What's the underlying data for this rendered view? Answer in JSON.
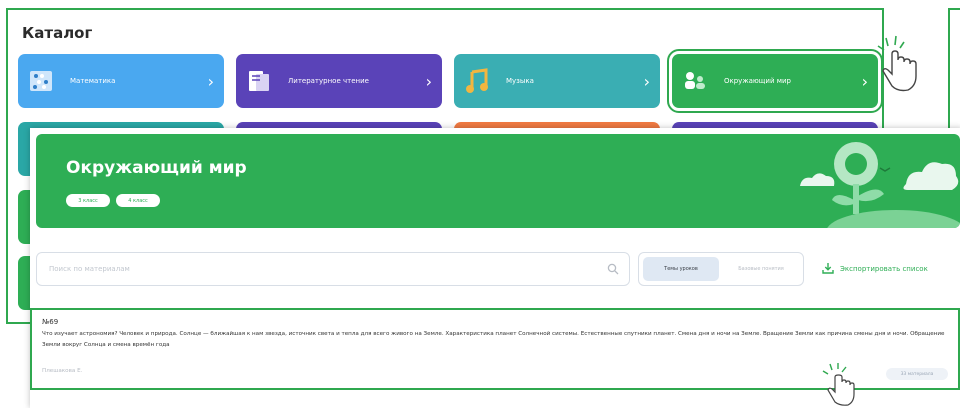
{
  "catalog": {
    "title": "Каталог",
    "tiles": [
      {
        "label": "Математика",
        "color": "#4aa8f0",
        "icon": "abacus-icon"
      },
      {
        "label": "Литературное чтение",
        "color": "#5a43b8",
        "icon": "book-icon"
      },
      {
        "label": "Музыка",
        "color": "#3aaeb3",
        "icon": "music-note-icon"
      },
      {
        "label": "Окружающий мир",
        "color": "#2eae55",
        "icon": "people-nature-icon"
      }
    ],
    "row2_colors": [
      "#2aa7a6",
      "#5a43b8",
      "#f07a43",
      "#5a43b8"
    ]
  },
  "subject": {
    "title": "Окружающий мир",
    "grades": [
      "3 класс",
      "4 класс"
    ],
    "banner_color": "#2eae55"
  },
  "search": {
    "placeholder": "Поиск по материалам"
  },
  "view_toggle": {
    "topics": "Темы уроков",
    "concepts": "Базовые понятия"
  },
  "export": {
    "label": "Экспортировать список"
  },
  "item": {
    "number": "№69",
    "description": "Что изучает астрономия? Человек и природа. Солнце — ближайшая к нам звезда, источник света и тепла для всего живого на Земле. Характеристика планет Солнечной системы. Естественные спутники планет. Смена дня и ночи на Земле. Вращение Земли как причина смены дня и ночи. Обращение Земли вокруг Солнца и смена времён года",
    "author": "Плешакова Е.",
    "materials": "33 материала"
  }
}
